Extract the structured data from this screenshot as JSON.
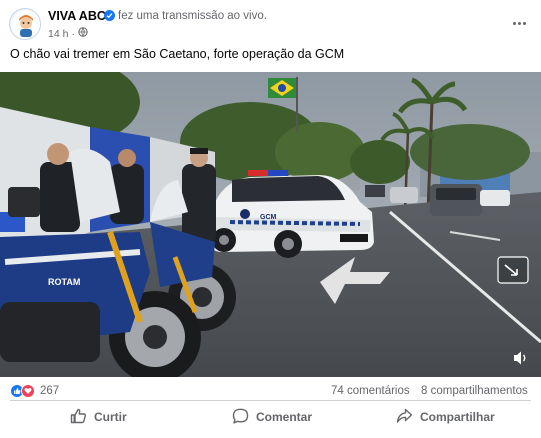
{
  "post": {
    "page_name": "VIVA ABC",
    "action_text": "fez uma transmissão ao vivo.",
    "time": "14 h",
    "audience_icon": "globe-icon",
    "text": "O chão vai tremer em São Caetano, forte operação da GCM"
  },
  "video": {
    "scene": "GCM motorcycles and patrol car on a street in São Caetano",
    "vest_label": "ROTAM",
    "car_label": "GCM",
    "controls": [
      "picture-in-picture-icon",
      "volume-icon"
    ]
  },
  "stats": {
    "reaction_icons": [
      "like-icon",
      "love-icon"
    ],
    "reactions_count": "267",
    "comments": "74 comentários",
    "shares": "8 compartilhamentos"
  },
  "actions": {
    "like": "Curtir",
    "comment": "Comentar",
    "share": "Compartilhar"
  },
  "colors": {
    "brand_blue": "#1877f2",
    "love_red": "#f33e58",
    "secondary_text": "#65676b"
  }
}
